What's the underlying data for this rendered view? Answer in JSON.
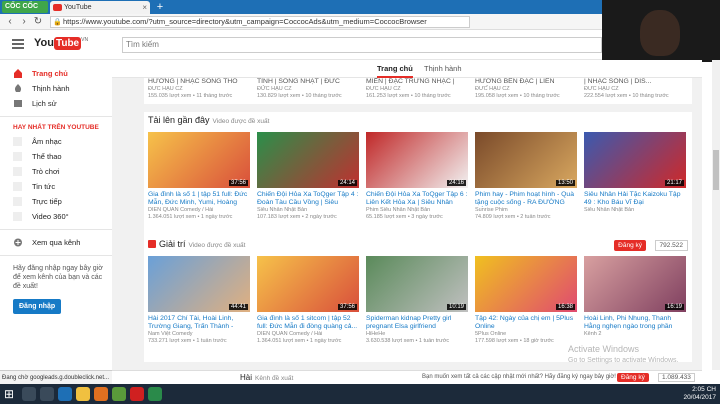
{
  "browser": {
    "brand": "CỐC CỐC",
    "tab_title": "YouTube",
    "tab_close": "×",
    "new_tab": "+",
    "url": "https://www.youtube.com/?utm_source=directory&utm_campaign=CoccocAds&utm_medium=CoccocBrowser",
    "status_text": "Đang chờ googleads.g.doubleclick.net..."
  },
  "yt": {
    "logo_you": "You",
    "logo_tube": "Tube",
    "logo_region": "VN",
    "search_placeholder": "Tìm kiếm"
  },
  "sidebar": {
    "items": [
      {
        "label": "Trang chủ",
        "active": true
      },
      {
        "label": "Thịnh hành",
        "active": false
      },
      {
        "label": "Lịch sử",
        "active": false
      }
    ],
    "section_heading": "HAY NHẤT TRÊN YOUTUBE",
    "categories": [
      "Âm nhạc",
      "Thể thao",
      "Trò chơi",
      "Tin tức",
      "Trực tiếp",
      "Video 360°"
    ],
    "browse_channels": "Xem qua kênh",
    "login_prompt": "Hãy đăng nhập ngay bây giờ để xem kênh của bạn và các đề xuất!",
    "login_button": "Đăng nhập"
  },
  "main": {
    "tabs": [
      {
        "label": "Trang chủ",
        "active": true
      },
      {
        "label": "Thịnh hành",
        "active": false
      }
    ],
    "top_row": [
      {
        "title": "HƯƠNG | NHẠC SỐNG THÔ TIN...",
        "channel": "ĐỨC HẬU CZ",
        "meta": "155.035 lượt xem • 11 tháng trước"
      },
      {
        "title": "TÌNH | SỐNG NHẠT | ĐỨC LÚA...",
        "channel": "ĐỨC HẬU CZ",
        "meta": "130.829 lượt xem • 10 tháng trước"
      },
      {
        "title": "MIỀN | ĐẶC TRƯNG NHẠC | DIS...",
        "channel": "ĐỨC HẬU CZ",
        "meta": "161.253 lượt xem • 10 tháng trước"
      },
      {
        "title": "HƯƠNG BÊN ĐẶC | LIÊN KHÚC...",
        "channel": "ĐỨC HẬU CZ",
        "meta": "195.058 lượt xem • 10 tháng trước"
      },
      {
        "title": "| NHẠC SỐNG | DIS...",
        "channel": "ĐỨC HẬU CZ",
        "meta": "222.554 lượt xem • 10 tháng trước"
      }
    ],
    "recent": {
      "title": "Tải lên gần đây",
      "subtitle": "Video được đề xuất",
      "videos": [
        {
          "title": "Gia đình là số 1 | tập 51 full: Đức Mẫn, Đức Minh, Yumi, Hoàng Đệ...",
          "channel": "DIEN QUAN Comedy / Hài",
          "meta": "1.364.051 lượt xem • 1 ngày trước",
          "duration": "37:56",
          "c1": "#f6c24a",
          "c2": "#d94f3b"
        },
        {
          "title": "Chiến Đội Hỏa Xa ToQger Tập 4 : Đoàn Tàu Cầu Vồng | Siêu Nhân...",
          "channel": "Siêu Nhân Nhật Bản",
          "meta": "107.183 lượt xem • 2 ngày trước",
          "duration": "24:14",
          "c1": "#2a8f4a",
          "c2": "#c03030"
        },
        {
          "title": "Chiến Đội Hỏa Xa ToQger Tập 6 : Liên Kết Hỏa Xa | Siêu Nhân Nhật...",
          "channel": "Phim Siêu Nhân Nhật Bản",
          "meta": "65.185 lượt xem • 3 ngày trước",
          "duration": "24:16",
          "c1": "#c02828",
          "c2": "#f2f2f2"
        },
        {
          "title": "Phim hay - Phim hoạt hình - Quà tặng cuộc sống - RA ĐƯỜNG ĐỜ...",
          "channel": "Sunrise Phim",
          "meta": "74.809 lượt xem • 2 tuần trước",
          "duration": "13:50",
          "c1": "#7a4a2a",
          "c2": "#d9a860"
        },
        {
          "title": "Siêu Nhân Hải Tặc Kaizoku Tập 49 : Kho Báu Vĩ Đại",
          "channel": "Siêu Nhân Nhật Bản",
          "meta": "",
          "duration": "21:17",
          "c1": "#3a5ab0",
          "c2": "#d02828"
        }
      ]
    },
    "entertainment": {
      "title": "Giải trí",
      "subtitle": "Video được đề xuất",
      "subscribe": "Đăng ký",
      "subscribers": "792.522",
      "videos": [
        {
          "title": "Hài 2017 Chí Tài, Hoài Linh, Trường Giang, Trấn Thành - Hài...",
          "channel": "Nam Việt Comedy",
          "meta": "733.271 lượt xem • 1 tuần trước",
          "duration": "44:41",
          "c1": "#6aa0d8",
          "c2": "#e0b080"
        },
        {
          "title": "Gia đình là số 1 sitcom | tập 52 full: Đức Mẫn đi đòng quàng cả...",
          "channel": "DIEN QUAN Comedy / Hài",
          "meta": "1.364.051 lượt xem • 1 ngày trước",
          "duration": "37:56",
          "c1": "#f6c24a",
          "c2": "#d94f3b"
        },
        {
          "title": "Spiderman kidnap Pretty girl pregnant Elsa girlfriend",
          "channel": "HiHeHe",
          "meta": "3.630.538 lượt xem • 1 tuần trước",
          "duration": "10:19",
          "c1": "#5a8a5a",
          "c2": "#c0c0c0"
        },
        {
          "title": "Tập 42: Ngày của chị em | 5Plus Online",
          "channel": "5Plus Online",
          "meta": "177.598 lượt xem • 18 giờ trước",
          "duration": "16:38",
          "c1": "#f0c020",
          "c2": "#e04a70"
        },
        {
          "title": "Hoài Linh, Phi Nhung, Thanh Hằng nghẹn ngào trong phần thi...",
          "channel": "Kênh 2",
          "meta": "",
          "duration": "16:19",
          "c1": "#d8a0a0",
          "c2": "#804060"
        }
      ]
    },
    "next_section": {
      "title": "Hài",
      "subtitle": "Kênh đề xuất"
    },
    "bottom_prompt": "Bạn muốn xem tất cả các cập nhật mới nhất? Hãy đăng ký ngay bây giờ!",
    "bottom_subscribe": "Đăng ký",
    "bottom_count": "1.089.433"
  },
  "watermark": {
    "line1": "Activate Windows",
    "line2": "Go to Settings to activate Windows."
  },
  "taskbar": {
    "time": "2:05 CH",
    "date": "20/04/2017"
  }
}
